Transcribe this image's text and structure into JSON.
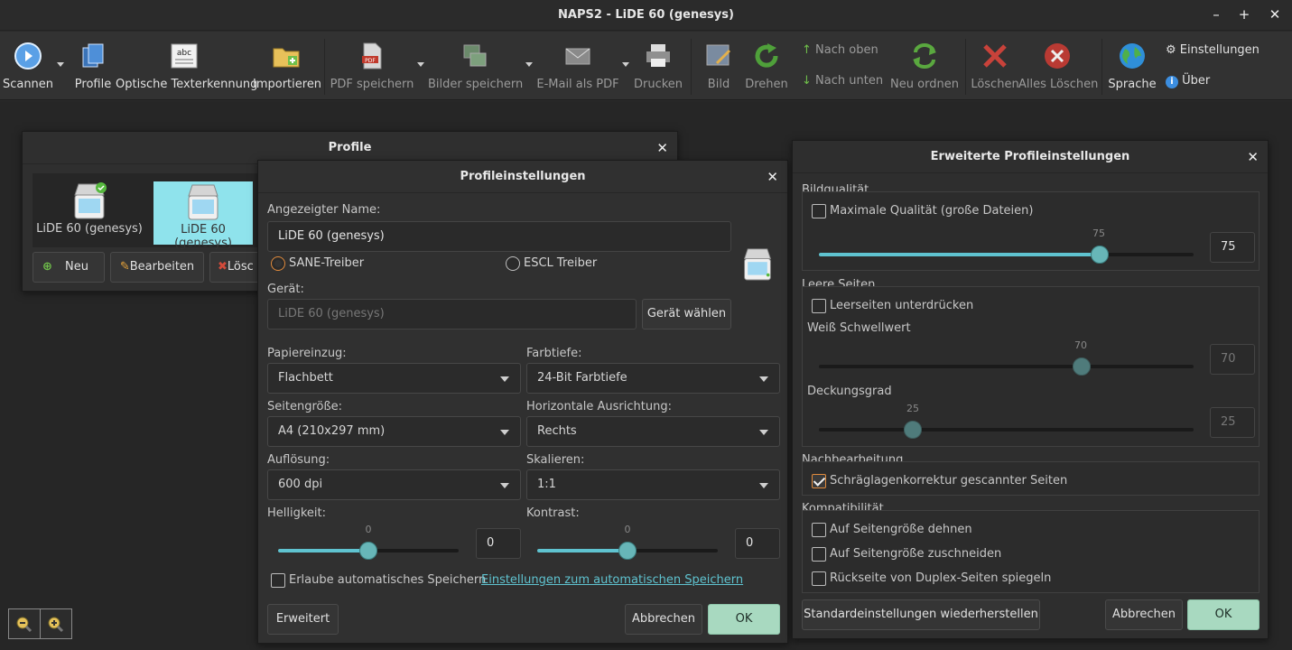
{
  "window": {
    "title": "NAPS2 - LiDE 60 (genesys)",
    "min": "–",
    "max": "+",
    "close": "✕"
  },
  "toolbar": {
    "scan": "Scannen",
    "profiles": "Profile",
    "ocr": "Optische Texterkennung",
    "import": "Importieren",
    "save_pdf": "PDF speichern",
    "save_images": "Bilder speichern",
    "email_pdf": "E-Mail als PDF",
    "print": "Drucken",
    "image": "Bild",
    "rotate": "Drehen",
    "move_up": "Nach oben",
    "move_down": "Nach unten",
    "reorder": "Neu ordnen",
    "delete": "Löschen",
    "delete_all": "Alles Löschen",
    "language": "Sprache",
    "settings": "Einstellungen",
    "about": "Über",
    "ocr_icon_text": "abc"
  },
  "profiles_dialog": {
    "title": "Profile",
    "close": "✕",
    "items": [
      "LiDE 60 (genesys)",
      "LiDE 60 (genesys)"
    ],
    "new": "Neu",
    "edit": "Bearbeiten",
    "delete": "Lösc"
  },
  "profile_settings": {
    "title": "Profileinstellungen",
    "close": "✕",
    "display_name_label": "Angezeigter Name:",
    "display_name_value": "LiDE 60 (genesys)",
    "driver_sane": "SANE-Treiber",
    "driver_escl": "ESCL Treiber",
    "device_label": "Gerät:",
    "device_value": "LiDE 60 (genesys)",
    "choose_device": "Gerät wählen",
    "paper_source_label": "Papiereinzug:",
    "paper_source": "Flachbett",
    "bit_depth_label": "Farbtiefe:",
    "bit_depth": "24-Bit Farbtiefe",
    "page_size_label": "Seitengröße:",
    "page_size": "A4 (210x297 mm)",
    "h_align_label": "Horizontale Ausrichtung:",
    "h_align": "Rechts",
    "resolution_label": "Auflösung:",
    "resolution": "600 dpi",
    "scale_label": "Skalieren:",
    "scale": "1:1",
    "brightness_label": "Helligkeit:",
    "brightness_tick": "0",
    "brightness_value": "0",
    "contrast_label": "Kontrast:",
    "contrast_tick": "0",
    "contrast_value": "0",
    "brightness_level": 0.5,
    "contrast_level": 0.5,
    "autosave_label": "Erlaube automatisches Speichern",
    "autosave_link": "Einstellungen zum automatischen Speichern",
    "advanced": "Erweitert",
    "cancel": "Abbrechen",
    "ok": "OK"
  },
  "advanced_dialog": {
    "title": "Erweiterte Profileinstellungen",
    "close": "✕",
    "image_quality_group": "Bildqualität",
    "max_quality_label": "Maximale Qualität (große Dateien)",
    "quality_tick": "75",
    "quality_value": "75",
    "quality_level": 0.75,
    "blank_pages_group": "Leere Seiten",
    "exclude_blank_label": "Leerseiten unterdrücken",
    "white_threshold_label": "Weiß Schwellwert",
    "white_tick": "70",
    "white_value": "70",
    "white_level": 0.7,
    "coverage_label": "Deckungsgrad",
    "coverage_tick": "25",
    "coverage_value": "25",
    "coverage_level": 0.25,
    "post_processing_group": "Nachbearbeitung",
    "deskew_label": "Schräglagenkorrektur gescannter Seiten",
    "compat_group": "Kompatibilität",
    "stretch_label": "Auf Seitengröße dehnen",
    "crop_label": "Auf Seitengröße zuschneiden",
    "flip_duplex_label": "Rückseite von Duplex-Seiten spiegeln",
    "restore_defaults": "Standardeinstellungen wiederherstellen",
    "cancel": "Abbrechen",
    "ok": "OK"
  },
  "colors": {
    "accent": "#5fc3d0",
    "ok_button": "#a8d9c0",
    "selected_item": "#8fe3ec",
    "radio_on": "#e08a3c"
  }
}
